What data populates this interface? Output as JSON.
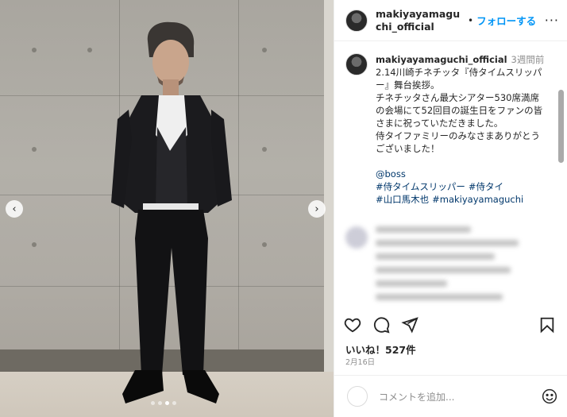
{
  "post": {
    "username": "makiyayamaguchi_official",
    "header_username": "makiyayamaguchi_official",
    "follow_separator": "•",
    "follow_label": "フォローする",
    "more_label": "···",
    "time_ago": "3週間前",
    "caption": "2.14川崎チネチッタ『侍タイムスリッパー』舞台挨拶。\nチネチッタさん最大シアター530席満席の会場にて52回目の誕生日をファンの皆さまに祝っていただきました。\n侍タイファミリーのみなさまありがとうございました！",
    "tags": [
      "@boss",
      "#侍タイムスリッパー",
      "#侍タイ",
      "#山口馬木也",
      "#makiyayamaguchi"
    ],
    "likes": "いいね！527件",
    "date": "2月16日",
    "comment_placeholder": "コメントを追加...",
    "carousel": {
      "total": 4,
      "active": 2
    }
  },
  "icons": {
    "prev": "chevron-left-icon",
    "next": "chevron-right-icon",
    "like": "heart-icon",
    "comment": "comment-icon",
    "share": "send-icon",
    "save": "bookmark-icon",
    "emoji": "emoji-icon"
  },
  "colors": {
    "link": "#0095f6",
    "hashtag": "#00376b",
    "muted": "#8e8e8e"
  }
}
